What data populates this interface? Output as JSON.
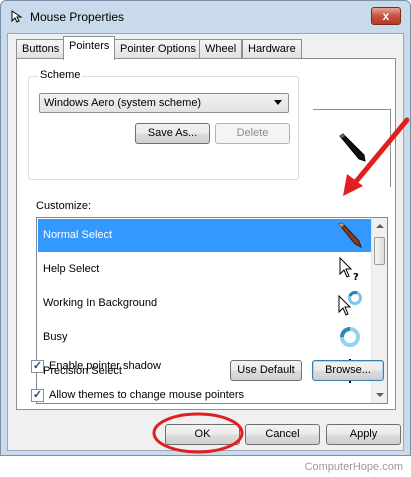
{
  "window": {
    "title": "Mouse Properties",
    "close_glyph": "x"
  },
  "tabs": [
    {
      "label": "Buttons",
      "active": false
    },
    {
      "label": "Pointers",
      "active": true
    },
    {
      "label": "Pointer Options",
      "active": false
    },
    {
      "label": "Wheel",
      "active": false
    },
    {
      "label": "Hardware",
      "active": false
    }
  ],
  "scheme": {
    "group_label": "Scheme",
    "selected": "Windows Aero (system scheme)",
    "save_as_label": "Save As...",
    "delete_label": "Delete"
  },
  "customize": {
    "label": "Customize:",
    "items": [
      {
        "label": "Normal Select",
        "icon": "pen-pointer-icon",
        "selected": true
      },
      {
        "label": "Help Select",
        "icon": "help-pointer-icon",
        "selected": false
      },
      {
        "label": "Working In Background",
        "icon": "working-pointer-icon",
        "selected": false
      },
      {
        "label": "Busy",
        "icon": "busy-icon",
        "selected": false
      },
      {
        "label": "Precision Select",
        "icon": "crosshair-icon",
        "selected": false
      }
    ]
  },
  "options": {
    "shadow_label": "Enable pointer shadow",
    "shadow_checked": true,
    "use_default_label": "Use Default",
    "browse_label": "Browse...",
    "themes_label": "Allow themes to change mouse pointers",
    "themes_checked": true
  },
  "footer": {
    "ok_label": "OK",
    "cancel_label": "Cancel",
    "apply_label": "Apply"
  },
  "watermark": "ComputerHope.com",
  "colors": {
    "selection": "#3399ff",
    "annotation_red": "#e02020"
  }
}
